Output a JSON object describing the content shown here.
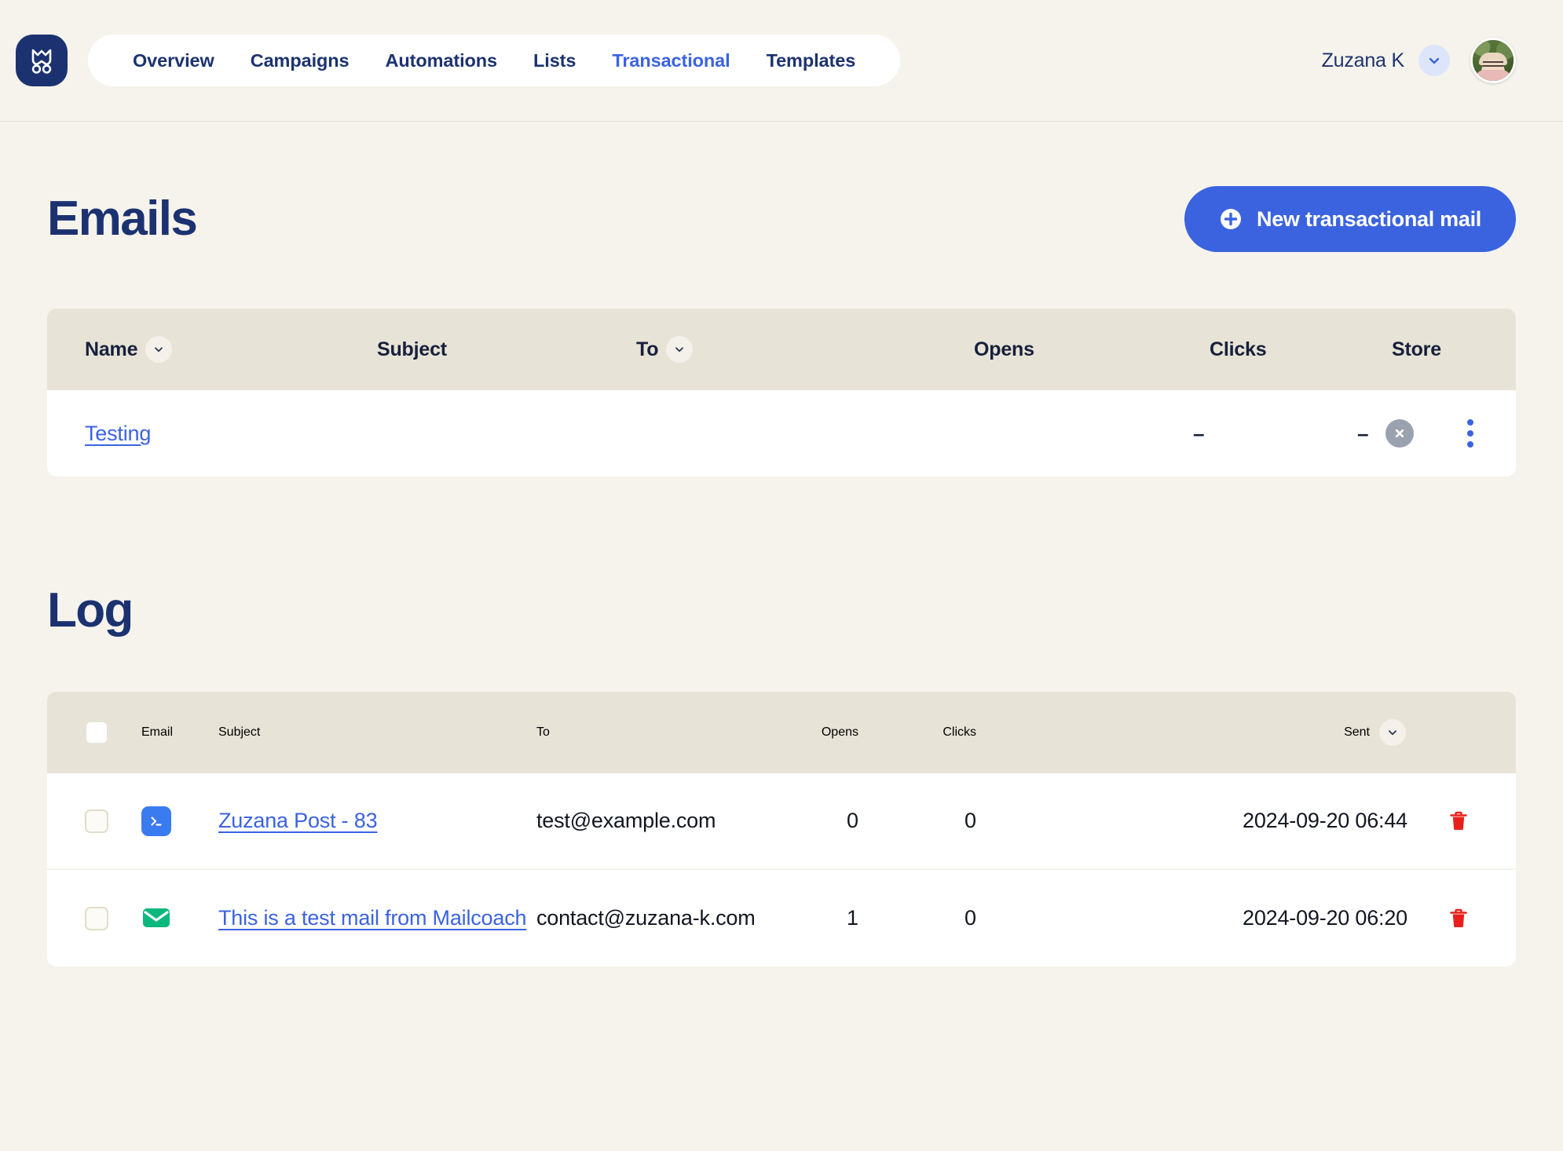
{
  "nav": {
    "logo_icon": "mailcoach-owl-logo",
    "items": [
      {
        "label": "Overview",
        "active": false
      },
      {
        "label": "Campaigns",
        "active": false
      },
      {
        "label": "Automations",
        "active": false
      },
      {
        "label": "Lists",
        "active": false
      },
      {
        "label": "Transactional",
        "active": true
      },
      {
        "label": "Templates",
        "active": false
      }
    ],
    "user": {
      "name": "Zuzana K",
      "chevron_icon": "chevron-down-icon",
      "avatar_icon": "user-avatar"
    }
  },
  "emails_section": {
    "title": "Emails",
    "new_button": {
      "label": "New transactional mail",
      "icon": "plus-circle-icon"
    },
    "columns": {
      "name": "Name",
      "subject": "Subject",
      "to": "To",
      "opens": "Opens",
      "clicks": "Clicks",
      "store": "Store"
    },
    "rows": [
      {
        "name": "Testing",
        "subject": "",
        "to": "",
        "opens": "–",
        "clicks": "–",
        "store_icon": "x-circle-icon",
        "menu_icon": "kebab-menu-icon"
      }
    ]
  },
  "log_section": {
    "title": "Log",
    "columns": {
      "email": "Email",
      "subject": "Subject",
      "to": "To",
      "opens": "Opens",
      "clicks": "Clicks",
      "sent": "Sent"
    },
    "rows": [
      {
        "type_icon": "terminal-icon",
        "subject": "Zuzana Post - 83",
        "to": "test@example.com",
        "opens": "0",
        "clicks": "0",
        "sent": "2024-09-20 06:44",
        "delete_icon": "trash-icon"
      },
      {
        "type_icon": "envelope-icon",
        "subject": "This is a test mail from Mailcoach",
        "to": "contact@zuzana-k.com",
        "opens": "1",
        "clicks": "0",
        "sent": "2024-09-20 06:20",
        "delete_icon": "trash-icon"
      }
    ]
  },
  "colors": {
    "page_background": "#F5F3EC",
    "navy": "#1C3270",
    "accent_blue": "#3B63E0",
    "table_header": "#E7E3D6",
    "terminal_icon": "#3B7BF0",
    "envelope_icon": "#0DB87F",
    "trash_icon": "#E8201C",
    "store_disabled": "#9AA2B0"
  }
}
